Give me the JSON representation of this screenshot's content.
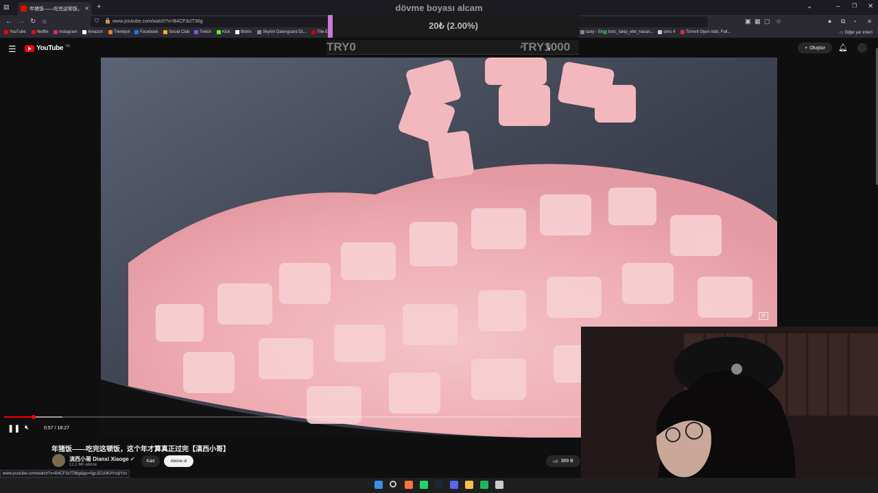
{
  "browser": {
    "tab_title": "年猪饭——吃完这顿饭，这个年",
    "url": "www.youtube.com/watch?v=B4CF3cIT36g",
    "bookmarks": [
      {
        "label": "YouTube",
        "color": "#ff0000"
      },
      {
        "label": "Netflix",
        "color": "#e50914"
      },
      {
        "label": "Instagram",
        "color": "#d62976"
      },
      {
        "label": "Amazon",
        "color": "#ffffff"
      },
      {
        "label": "Trendyol",
        "color": "#f27a1a"
      },
      {
        "label": "Facebook",
        "color": "#1877f2"
      },
      {
        "label": "Social Club",
        "color": "#fcaf17"
      },
      {
        "label": "Twitch",
        "color": "#9146ff"
      },
      {
        "label": "Kick",
        "color": "#53fc18"
      },
      {
        "label": "Botrix",
        "color": "#ffffff"
      },
      {
        "label": "Skyrim Dawnguard DL...",
        "color": "#888888"
      },
      {
        "label": "The E",
        "color": "#cc0000"
      }
    ],
    "bookmarks_right": [
      {
        "label": "tasty - Ek...",
        "color": "#888888"
      },
      {
        "label": "borc_takip_efet_hasan...",
        "color": "#1e8e3e"
      },
      {
        "label": "sims 4",
        "color": "#cccccc"
      },
      {
        "label": "Torrent Oyun indir, Full...",
        "color": "#cc3333"
      }
    ],
    "other_bookmarks": "Diğer yer imleri"
  },
  "donation": {
    "title": "dövme boyası alcam",
    "amount": "20₺ (2.00%)",
    "goal_min": "TRY0",
    "goal_max": "TRY1000",
    "progress": 0.02,
    "accent": "#c87bd8"
  },
  "youtube": {
    "logo_text": "YouTube",
    "logo_region": "TR",
    "create_label": "Oluştur",
    "player": {
      "time": "0:57 / 18:27",
      "progress": 0.0515
    },
    "video_title": "年猪饭——吃完这顿饭，这个年才算真正过完【滇西小哥】",
    "channel_name": "滇西小哥 Dianxi Xiaoge",
    "channel_subs": "12,1 Mn abone",
    "join_label": "Katıl",
    "subscribe_label": "Abone ol",
    "likes": "369 B"
  },
  "status_url": "www.youtube.com/watch?v=B4CF3cIT36g&pp=0gcJCU0KAYcqIYzv",
  "icons": {
    "menu": "☰",
    "bell": "🔔",
    "pause": "❚❚",
    "mute": "🔇",
    "like": "👍",
    "plus": "+",
    "pip": "⧉"
  },
  "taskbar_apps": [
    {
      "name": "windows-start-icon",
      "color": "#3a8ee6"
    },
    {
      "name": "search-icon",
      "color": "#cccccc"
    },
    {
      "name": "firefox-icon",
      "color": "#ff7139"
    },
    {
      "name": "whatsapp-icon",
      "color": "#25d366"
    },
    {
      "name": "steam-icon",
      "color": "#1b2838"
    },
    {
      "name": "discord-icon",
      "color": "#5865f2"
    },
    {
      "name": "file-explorer-icon",
      "color": "#f8c13c"
    },
    {
      "name": "spotify-icon",
      "color": "#1db954"
    },
    {
      "name": "app-icon",
      "color": "#cccccc"
    }
  ]
}
